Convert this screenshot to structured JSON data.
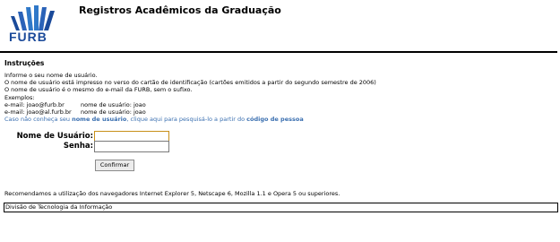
{
  "header": {
    "logo_text": "FURB",
    "title": "Registros Acadêmicos da Graduação"
  },
  "instructions": {
    "heading": "Instruções",
    "lines": [
      "Informe o seu nome de usuário.",
      "O nome de usuário está impresso no verso do cartão de identificação (cartões emitidos a partir do segundo semestre de 2006)",
      "O nome de usuário é o mesmo do e-mail da FURB, sem o sufixo.",
      "Exemplos:"
    ],
    "examples": [
      {
        "email": "e-mail: joao@furb.br",
        "user": "nome de usuário: joao"
      },
      {
        "email": "e-mail: joao@al.furb.br",
        "user": "nome de usuário: joao"
      }
    ],
    "link": {
      "prefix": "Caso não conheça seu ",
      "bold1": "nome de usuário",
      "middle": ", clique aqui para pesquisá-lo a partir do ",
      "bold2": "código de pessoa"
    }
  },
  "form": {
    "username_label": "Nome de Usuário:",
    "password_label": "Senha:",
    "username_value": "",
    "password_value": "",
    "submit_label": "Confirmar"
  },
  "browser_note": "Recomendamos a utilização dos navegadores Internet Explorer 5, Netscape 6, Mozilla 1.1 e Opera 5 ou superiores.",
  "footer": "Divisão de Tecnologia da Informação",
  "colors": {
    "link": "#3a6fb0",
    "logo": "#1b4a9a",
    "focus": "#c8901a"
  }
}
